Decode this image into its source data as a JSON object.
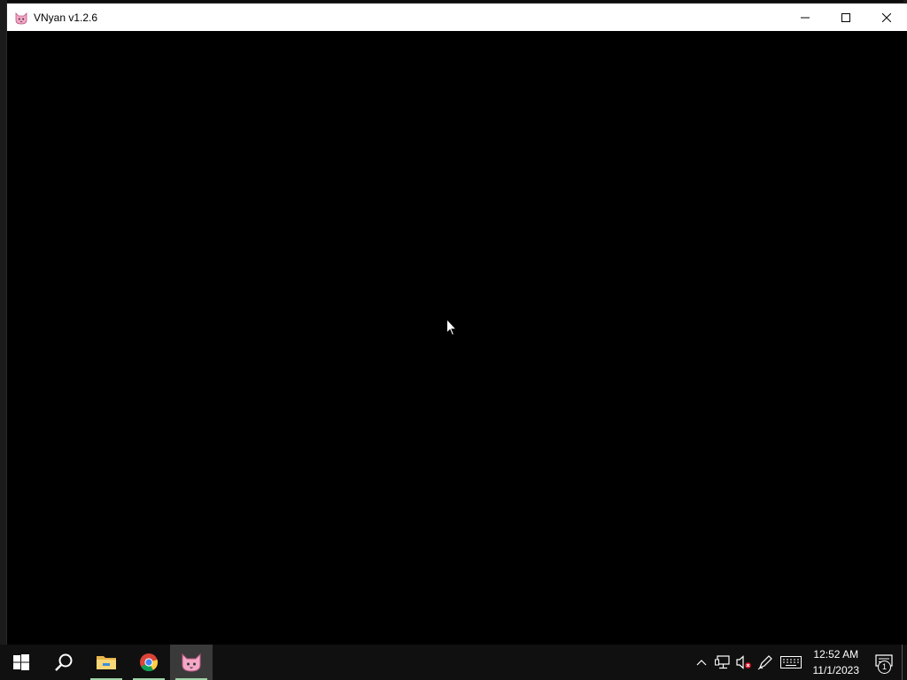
{
  "window": {
    "title": "VNyan v1.2.6",
    "icon": "cat-face-icon",
    "controls": {
      "minimize": "minimize-icon",
      "maximize": "maximize-icon",
      "close": "close-icon"
    }
  },
  "taskbar": {
    "apps": [
      {
        "name": "start",
        "icon": "windows-logo-icon"
      },
      {
        "name": "search",
        "icon": "search-icon"
      },
      {
        "name": "file-explorer",
        "icon": "folder-icon"
      },
      {
        "name": "chrome",
        "icon": "chrome-icon"
      },
      {
        "name": "vnyan",
        "icon": "cat-face-icon"
      }
    ],
    "tray": {
      "icons": [
        "chevron-up-icon",
        "network-icon",
        "volume-muted-icon",
        "pen-icon",
        "keyboard-icon"
      ],
      "time": "12:52 AM",
      "date": "11/1/2023",
      "notification_count": "1"
    }
  },
  "colors": {
    "titlebar": "#ffffff",
    "viewport": "#000000",
    "taskbar": "#101010",
    "running_indicator": "#76b9ed",
    "cat_pink": "#f4a7c6"
  }
}
